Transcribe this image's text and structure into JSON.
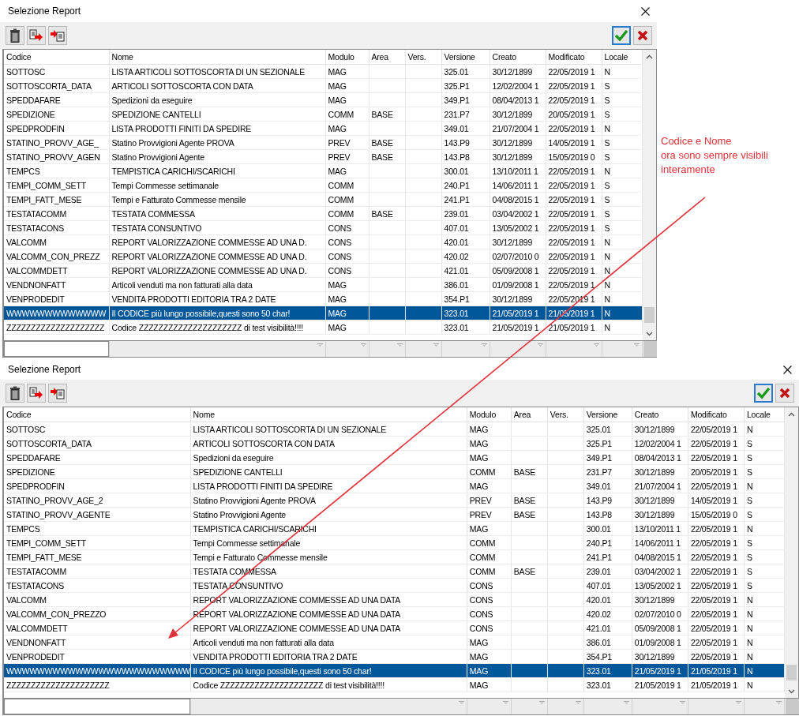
{
  "windows": [
    {
      "title": "Selezione Report",
      "columns": [
        "Codice",
        "Nome",
        "Modulo",
        "Area",
        "Vers.",
        "Versione",
        "Creato",
        "Modificato",
        "Locale"
      ],
      "rows": [
        {
          "codice": "SOTTOSC",
          "nome": "LISTA ARTICOLI SOTTOSCORTA DI UN SEZIONALE",
          "modulo": "MAG",
          "versione": "325.01",
          "creato": "30/12/1899",
          "modificato": "22/05/2019 1",
          "locale": "N",
          "selected": false
        },
        {
          "codice": "SOTTOSCORTA_DATA",
          "nome": "ARTICOLI SOTTOSCORTA CON DATA",
          "modulo": "MAG",
          "versione": "325.P1",
          "creato": "12/02/2004 1",
          "modificato": "22/05/2019 1",
          "locale": "S",
          "selected": false
        },
        {
          "codice": "SPEDDAFARE",
          "nome": "Spedizioni da eseguire",
          "modulo": "MAG",
          "versione": "349.P1",
          "creato": "08/04/2013 1",
          "modificato": "22/05/2019 1",
          "locale": "S",
          "selected": false
        },
        {
          "codice": "SPEDIZIONE",
          "nome": "SPEDIZIONE CANTELLI",
          "modulo": "COMM",
          "area": "BASE",
          "versione": "231.P7",
          "creato": "30/12/1899",
          "modificato": "20/05/2019 1",
          "locale": "S",
          "selected": false
        },
        {
          "codice": "SPEDPRODFIN",
          "nome": "LISTA PRODOTTI FINITI DA SPEDIRE",
          "modulo": "MAG",
          "versione": "349.01",
          "creato": "21/07/2004 1",
          "modificato": "22/05/2019 1",
          "locale": "N",
          "selected": false
        },
        {
          "codice": "STATINO_PROVV_AGE_",
          "nome": "Statino Provvigioni Agente PROVA",
          "modulo": "PREV",
          "area": "BASE",
          "versione": "143.P9",
          "creato": "30/12/1899",
          "modificato": "14/05/2019 1",
          "locale": "S",
          "selected": false
        },
        {
          "codice": "STATINO_PROVV_AGEN",
          "nome": "Statino Provvigioni Agente",
          "modulo": "PREV",
          "area": "BASE",
          "versione": "143.P8",
          "creato": "30/12/1899",
          "modificato": "15/05/2019 0",
          "locale": "S",
          "selected": false
        },
        {
          "codice": "TEMPCS",
          "nome": "TEMPISTICA CARICHI/SCARICHI",
          "modulo": "MAG",
          "versione": "300.01",
          "creato": "13/10/2011 1",
          "modificato": "22/05/2019 1",
          "locale": "N",
          "selected": false
        },
        {
          "codice": "TEMPI_COMM_SETT",
          "nome": "Tempi Commesse settimanale",
          "modulo": "COMM",
          "versione": "240.P1",
          "creato": "14/06/2011 1",
          "modificato": "22/05/2019 1",
          "locale": "S",
          "selected": false
        },
        {
          "codice": "TEMPI_FATT_MESE",
          "nome": "Tempi e Fatturato Commesse mensile",
          "modulo": "COMM",
          "versione": "241.P1",
          "creato": "04/08/2015 1",
          "modificato": "22/05/2019 1",
          "locale": "S",
          "selected": false
        },
        {
          "codice": "TESTATACOMM",
          "nome": "TESTATA COMMESSA",
          "modulo": "COMM",
          "area": "BASE",
          "versione": "239.01",
          "creato": "03/04/2002 1",
          "modificato": "22/05/2019 1",
          "locale": "S",
          "selected": false
        },
        {
          "codice": "TESTATACONS",
          "nome": "TESTATA CONSUNTIVO",
          "modulo": "CONS",
          "versione": "407.01",
          "creato": "13/05/2002 1",
          "modificato": "22/05/2019 1",
          "locale": "S",
          "selected": false
        },
        {
          "codice": "VALCOMM",
          "nome": "REPORT VALORIZZAZIONE COMMESSE AD UNA D.",
          "modulo": "CONS",
          "versione": "420.01",
          "creato": "30/12/1899",
          "modificato": "22/05/2019 1",
          "locale": "N",
          "selected": false
        },
        {
          "codice": "VALCOMM_CON_PREZZ",
          "nome": "REPORT VALORIZZAZIONE COMMESSE AD UNA D.",
          "modulo": "CONS",
          "versione": "420.02",
          "creato": "02/07/2010 0",
          "modificato": "22/05/2019 1",
          "locale": "N",
          "selected": false
        },
        {
          "codice": "VALCOMMDETT",
          "nome": "REPORT VALORIZZAZIONE COMMESSE AD UNA D.",
          "modulo": "CONS",
          "versione": "421.01",
          "creato": "05/09/2008 1",
          "modificato": "22/05/2019 1",
          "locale": "N",
          "selected": false
        },
        {
          "codice": "VENDNONFATT",
          "nome": "Articoli venduti ma non fatturati alla data",
          "modulo": "MAG",
          "versione": "386.01",
          "creato": "01/09/2008 1",
          "modificato": "22/05/2019 1",
          "locale": "N",
          "selected": false
        },
        {
          "codice": "VENPRODEDIT",
          "nome": "VENDITA PRODOTTI EDITORIA TRA 2 DATE",
          "modulo": "MAG",
          "versione": "354.P1",
          "creato": "30/12/1899",
          "modificato": "22/05/2019 1",
          "locale": "N",
          "selected": false
        },
        {
          "codice": "WWWWWWWWWWWWW",
          "nome": "Il CODICE più lungo possibile,questi sono 50 char!",
          "modulo": "MAG",
          "versione": "323.01",
          "creato": "21/05/2019 1",
          "modificato": "21/05/2019 1",
          "locale": "N",
          "selected": true
        },
        {
          "codice": "ZZZZZZZZZZZZZZZZZZZZ",
          "nome": "Codice ZZZZZZZZZZZZZZZZZZZZZ di test visibilità!!!!",
          "modulo": "MAG",
          "versione": "323.01",
          "creato": "21/05/2019 1",
          "modificato": "21/05/2019 1",
          "locale": "N",
          "selected": false
        }
      ]
    },
    {
      "title": "Selezione Report",
      "columns": [
        "Codice",
        "Nome",
        "Modulo",
        "Area",
        "Vers.",
        "Versione",
        "Creato",
        "Modificato",
        "Locale"
      ],
      "rows": [
        {
          "codice": "SOTTOSC",
          "nome": "LISTA ARTICOLI SOTTOSCORTA DI UN SEZIONALE",
          "modulo": "MAG",
          "versione": "325.01",
          "creato": "30/12/1899",
          "modificato": "22/05/2019 1",
          "locale": "N",
          "selected": false
        },
        {
          "codice": "SOTTOSCORTA_DATA",
          "nome": "ARTICOLI SOTTOSCORTA CON DATA",
          "modulo": "MAG",
          "versione": "325.P1",
          "creato": "12/02/2004 1",
          "modificato": "22/05/2019 1",
          "locale": "S",
          "selected": false
        },
        {
          "codice": "SPEDDAFARE",
          "nome": "Spedizioni da eseguire",
          "modulo": "MAG",
          "versione": "349.P1",
          "creato": "08/04/2013 1",
          "modificato": "22/05/2019 1",
          "locale": "S",
          "selected": false
        },
        {
          "codice": "SPEDIZIONE",
          "nome": "SPEDIZIONE CANTELLI",
          "modulo": "COMM",
          "area": "BASE",
          "versione": "231.P7",
          "creato": "30/12/1899",
          "modificato": "20/05/2019 1",
          "locale": "S",
          "selected": false
        },
        {
          "codice": "SPEDPRODFIN",
          "nome": "LISTA PRODOTTI FINITI DA SPEDIRE",
          "modulo": "MAG",
          "versione": "349.01",
          "creato": "21/07/2004 1",
          "modificato": "22/05/2019 1",
          "locale": "N",
          "selected": false
        },
        {
          "codice": "STATINO_PROVV_AGE_2",
          "nome": "Statino Provvigioni Agente PROVA",
          "modulo": "PREV",
          "area": "BASE",
          "versione": "143.P9",
          "creato": "30/12/1899",
          "modificato": "14/05/2019 1",
          "locale": "S",
          "selected": false
        },
        {
          "codice": "STATINO_PROVV_AGENTE",
          "nome": "Statino Provvigioni Agente",
          "modulo": "PREV",
          "area": "BASE",
          "versione": "143.P8",
          "creato": "30/12/1899",
          "modificato": "15/05/2019 0",
          "locale": "S",
          "selected": false
        },
        {
          "codice": "TEMPCS",
          "nome": "TEMPISTICA CARICHI/SCARICHI",
          "modulo": "MAG",
          "versione": "300.01",
          "creato": "13/10/2011 1",
          "modificato": "22/05/2019 1",
          "locale": "N",
          "selected": false
        },
        {
          "codice": "TEMPI_COMM_SETT",
          "nome": "Tempi Commesse settimanale",
          "modulo": "COMM",
          "versione": "240.P1",
          "creato": "14/06/2011 1",
          "modificato": "22/05/2019 1",
          "locale": "S",
          "selected": false
        },
        {
          "codice": "TEMPI_FATT_MESE",
          "nome": "Tempi e Fatturato Commesse mensile",
          "modulo": "COMM",
          "versione": "241.P1",
          "creato": "04/08/2015 1",
          "modificato": "22/05/2019 1",
          "locale": "S",
          "selected": false
        },
        {
          "codice": "TESTATACOMM",
          "nome": "TESTATA COMMESSA",
          "modulo": "COMM",
          "area": "BASE",
          "versione": "239.01",
          "creato": "03/04/2002 1",
          "modificato": "22/05/2019 1",
          "locale": "S",
          "selected": false
        },
        {
          "codice": "TESTATACONS",
          "nome": "TESTATA CONSUNTIVO",
          "modulo": "CONS",
          "versione": "407.01",
          "creato": "13/05/2002 1",
          "modificato": "22/05/2019 1",
          "locale": "S",
          "selected": false
        },
        {
          "codice": "VALCOMM",
          "nome": "REPORT VALORIZZAZIONE COMMESSE AD UNA DATA",
          "modulo": "CONS",
          "versione": "420.01",
          "creato": "30/12/1899",
          "modificato": "22/05/2019 1",
          "locale": "N",
          "selected": false
        },
        {
          "codice": "VALCOMM_CON_PREZZO",
          "nome": "REPORT VALORIZZAZIONE COMMESSE AD UNA DATA",
          "modulo": "CONS",
          "versione": "420.02",
          "creato": "02/07/2010 0",
          "modificato": "22/05/2019 1",
          "locale": "N",
          "selected": false
        },
        {
          "codice": "VALCOMMDETT",
          "nome": "REPORT VALORIZZAZIONE COMMESSE AD UNA DATA",
          "modulo": "CONS",
          "versione": "421.01",
          "creato": "05/09/2008 1",
          "modificato": "22/05/2019 1",
          "locale": "N",
          "selected": false
        },
        {
          "codice": "VENDNONFATT",
          "nome": "Articoli venduti ma non fatturati alla data",
          "modulo": "MAG",
          "versione": "386.01",
          "creato": "01/09/2008 1",
          "modificato": "22/05/2019 1",
          "locale": "N",
          "selected": false
        },
        {
          "codice": "VENPRODEDIT",
          "nome": "VENDITA PRODOTTI EDITORIA TRA 2 DATE",
          "modulo": "MAG",
          "versione": "354.P1",
          "creato": "30/12/1899",
          "modificato": "22/05/2019 1",
          "locale": "N",
          "selected": false
        },
        {
          "codice": "WWWWWWWWWWWWWWWWWWWWWWWW",
          "nome": "Il CODICE più lungo possibile,questi sono 50 char!",
          "modulo": "MAG",
          "versione": "323.01",
          "creato": "21/05/2019 1",
          "modificato": "21/05/2019 1",
          "locale": "N",
          "selected": true
        },
        {
          "codice": "ZZZZZZZZZZZZZZZZZZZZZ",
          "nome": "Codice ZZZZZZZZZZZZZZZZZZZZZ di test visibilità!!!!",
          "modulo": "MAG",
          "versione": "323.01",
          "creato": "21/05/2019 1",
          "modificato": "21/05/2019 1",
          "locale": "N",
          "selected": false
        }
      ]
    }
  ],
  "annotation": {
    "lines": [
      "Codice e Nome",
      "ora sono sempre visibili",
      "interamente"
    ]
  }
}
